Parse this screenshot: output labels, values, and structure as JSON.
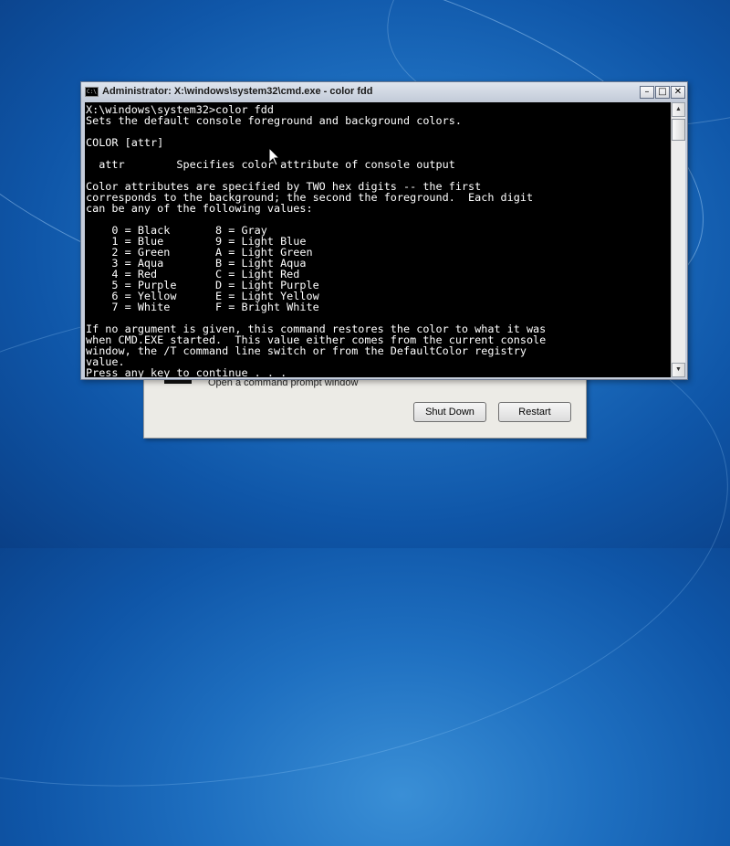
{
  "window": {
    "title": "Administrator: X:\\windows\\system32\\cmd.exe - color fdd",
    "app_icon": "C:\\",
    "minimize_icon": "minimize-icon",
    "maximize_icon": "maximize-icon",
    "close_icon": "close-icon"
  },
  "console": {
    "text": "X:\\windows\\system32>color fdd\nSets the default console foreground and background colors.\n\nCOLOR [attr]\n\n  attr        Specifies color attribute of console output\n\nColor attributes are specified by TWO hex digits -- the first\ncorresponds to the background; the second the foreground.  Each digit\ncan be any of the following values:\n\n    0 = Black       8 = Gray\n    1 = Blue        9 = Light Blue\n    2 = Green       A = Light Green\n    3 = Aqua        B = Light Aqua\n    4 = Red         C = Light Red\n    5 = Purple      D = Light Purple\n    6 = Yellow      E = Light Yellow\n    7 = White       F = Bright White\n\nIf no argument is given, this command restores the color to what it was\nwhen CMD.EXE started.  This value either comes from the current console\nwindow, the /T command line switch or from the DefaultColor registry\nvalue.\nPress any key to continue . . ."
  },
  "dialog": {
    "option_text": "Open a command prompt window",
    "shutdown_label": "Shut Down",
    "restart_label": "Restart"
  },
  "colors": {
    "console_bg": "#000000",
    "console_fg": "#ffffff",
    "desktop": "#1e6fc0"
  }
}
